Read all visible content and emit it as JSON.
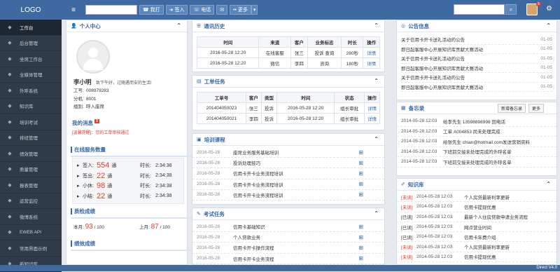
{
  "topbar": {
    "logo": "LOGO",
    "buttons": [
      "我打",
      "签入",
      "电话",
      "",
      "更多"
    ],
    "notif_count": "9"
  },
  "sidebar": {
    "items": [
      {
        "icon": "home-icon",
        "label": "工作台",
        "active": true
      },
      {
        "icon": "monitor-icon",
        "label": "后台管理"
      },
      {
        "icon": "users-icon",
        "label": "坐席工作台"
      },
      {
        "icon": "media-icon",
        "label": "全媒体管理"
      },
      {
        "icon": "phone-icon",
        "label": "外呼系统"
      },
      {
        "icon": "book-icon",
        "label": "知识库"
      },
      {
        "icon": "graduation-icon",
        "label": "培训考试"
      },
      {
        "icon": "calendar-icon",
        "label": "排班管理"
      },
      {
        "icon": "chart-icon",
        "label": "绩效管理"
      },
      {
        "icon": "quality-icon",
        "label": "质量管理"
      },
      {
        "icon": "report-icon",
        "label": "报表管理"
      },
      {
        "icon": "monitor-icon",
        "label": "运营监控"
      },
      {
        "icon": "weibo-icon",
        "label": "微博系统"
      },
      {
        "icon": "api-icon",
        "label": "EWEB API"
      },
      {
        "icon": "interface-icon",
        "label": "常用界面示例"
      },
      {
        "icon": "knowledge-icon",
        "label": "新知识库"
      }
    ]
  },
  "personal": {
    "title": "个人中心",
    "name": "李小明",
    "greeting": "致下午好，过随遇而安的生活!",
    "rows": [
      {
        "k": "工号:",
        "v": "008979283"
      },
      {
        "k": "分机:",
        "v": "8001"
      },
      {
        "k": "组别:",
        "v": "呼入座席"
      }
    ],
    "msg_title": "我的消息",
    "msg_count": "3",
    "msg_text": "[温馨提醒]：您的工单审核通过",
    "service_title": "在线服务数量",
    "stats": [
      {
        "label": "签入:",
        "num": "554",
        "unit": "通",
        "tk": "时长:",
        "tv": "2:34:38"
      },
      {
        "label": "签出:",
        "num": "22",
        "unit": "通",
        "tk": "时长:",
        "tv": "2:34:38"
      },
      {
        "label": "小休:",
        "num": "98",
        "unit": "通",
        "tk": "时长:",
        "tv": "2:34:38"
      },
      {
        "label": "小结:",
        "num": "22",
        "unit": "通",
        "tk": "时长:",
        "tv": "2:34:38"
      }
    ],
    "quality_title": "质检成绩",
    "quality": {
      "cur_label": "本月:",
      "cur": "93",
      "cur_total": "/ 100",
      "prev_label": "上月:",
      "prev": "87",
      "prev_total": "/ 100"
    },
    "perf_title": "绩效成绩"
  },
  "history": {
    "title": "通讯历史",
    "headers": [
      "时间",
      "来道",
      "客户",
      "业务标志",
      "时长",
      "操作"
    ],
    "rows": [
      [
        "2016-05-28 12:20",
        "在线客服",
        "张三",
        "投诉 查询",
        "280秒",
        "详情"
      ],
      [
        "2016-05-28 12:20",
        "微信",
        "李四",
        "咨询",
        "180秒",
        "详情"
      ]
    ]
  },
  "worktask": {
    "title": "工单任务",
    "headers": [
      "工单号",
      "客户",
      "类型",
      "时间",
      "状态",
      "操作"
    ],
    "rows": [
      [
        "201404050023",
        "张三",
        "投诉",
        "2016-05-28 12:20",
        "组长审批",
        "详情"
      ],
      [
        "201404050021",
        "李四",
        "投诉",
        "2016-05-28 12:20",
        "组长审批",
        "详情"
      ]
    ]
  },
  "training": {
    "title": "培训课程",
    "items": [
      {
        "date": "2016-05-28",
        "text": "座席业务服务基础培训"
      },
      {
        "date": "2016-05-28",
        "text": "投诉处理技巧"
      },
      {
        "date": "2016-05-28",
        "text": "信用卡开卡业务流程培训"
      },
      {
        "date": "2016-05-28",
        "text": "信用卡开卡业务流程培训"
      },
      {
        "date": "2016-05-28",
        "text": "信用卡开卡业务流程培训"
      }
    ]
  },
  "exam": {
    "title": "考试任务",
    "items": [
      {
        "date": "2016-05-28",
        "text": "信用卡基础知识"
      },
      {
        "date": "2016-05-28",
        "text": "个人贷款业务"
      },
      {
        "date": "2016-05-28",
        "text": "信用卡开卡操作流程"
      },
      {
        "date": "2016-05-28",
        "text": "信用卡开卡业务流程"
      }
    ]
  },
  "notice": {
    "title": "公告信息",
    "items": [
      {
        "text": "关于信用卡开卡送礼活动的公告",
        "date": "01-05"
      },
      {
        "text": "即日起客服中心开展知识库贡献大赛活动",
        "date": "01-05"
      },
      {
        "text": "关于信用卡开卡送礼活动的公告",
        "date": "01-05"
      },
      {
        "text": "即日起客服中心开展知识库贡献大赛活动",
        "date": "01-05"
      },
      {
        "text": "关于信用卡开卡送礼活动的公告",
        "date": "01-05"
      },
      {
        "text": "即日起客服中心开展知识库贡献大赛活动",
        "date": "01-05"
      }
    ]
  },
  "memo": {
    "title": "备忘录",
    "add": "新增备忘录",
    "more": "更多",
    "items": [
      {
        "date": "2014-05-28 12:03",
        "text": "给李先生 13598898998 回电话"
      },
      {
        "date": "2014-05-28 12:03",
        "text": "工单 A004853 尚未处理完成"
      },
      {
        "date": "2014-05-28 12:03",
        "text": "给张先生 chian@hotmail.com发送营销资料"
      },
      {
        "date": "2014-05-28 12:03",
        "text": "下班前交接未处理完成的外呼名单"
      },
      {
        "date": "2014-05-28 12:03",
        "text": "下班前交接未处理完成的外呼名单"
      }
    ]
  },
  "kb": {
    "title": "知识库",
    "items": [
      {
        "tag": "[未读]",
        "unread": true,
        "date": "2014-05-28 12:03",
        "text": "个人房贷最新利率更新"
      },
      {
        "tag": "[未读]",
        "unread": true,
        "date": "2014-05-28 12:03",
        "text": "信用卡提现优惠"
      },
      {
        "tag": "[已读]",
        "unread": false,
        "date": "2014-05-28 12:03",
        "text": "最新个人住房贷款申请业务流程"
      },
      {
        "tag": "[已读]",
        "unread": false,
        "date": "2014-05-28 12:03",
        "text": "网点营业时间"
      },
      {
        "tag": "[已读]",
        "unread": false,
        "date": "2014-05-28 12:03",
        "text": "信用卡年费介绍"
      },
      {
        "tag": "[未读]",
        "unread": true,
        "date": "2014-05-28 12:03",
        "text": "个人房贷最新利率更新"
      },
      {
        "tag": "[未读]",
        "unread": true,
        "date": "2014-05-28 12:03",
        "text": "信用卡提现优惠"
      }
    ]
  },
  "footer": {
    "version": "Direct V4.0"
  }
}
